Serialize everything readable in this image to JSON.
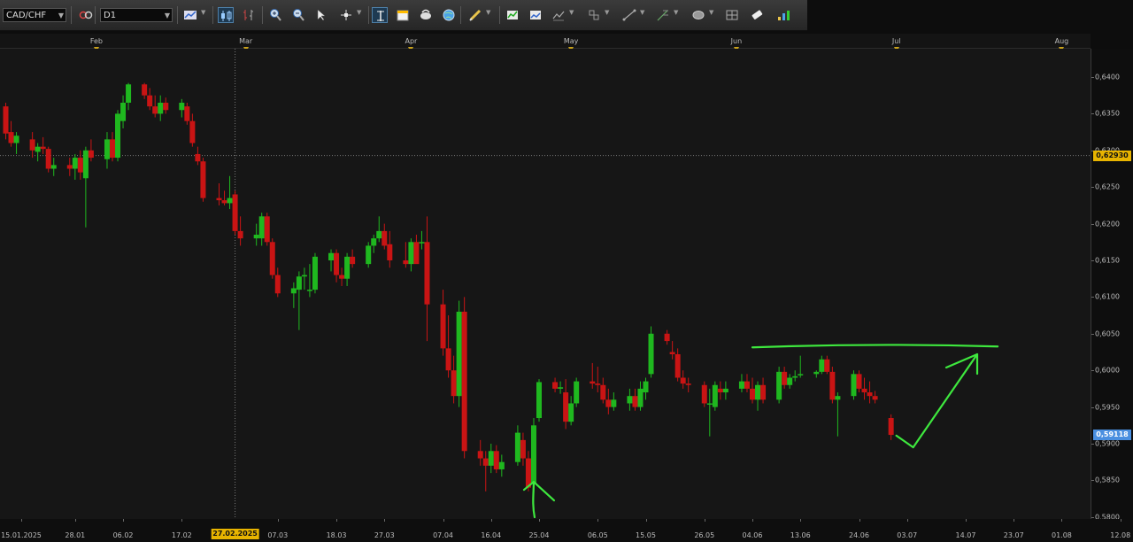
{
  "toolbar": {
    "symbol": "CAD/CHF",
    "timeframe": "D1",
    "buttons": [
      {
        "name": "link-icon",
        "x": 88,
        "drop": false,
        "active": false
      },
      {
        "name": "line-chart-icon",
        "x": 206,
        "drop": true,
        "active": false
      },
      {
        "name": "candlestick-icon",
        "x": 246,
        "drop": false,
        "active": true
      },
      {
        "name": "bar-chart-icon",
        "x": 272,
        "drop": false,
        "active": false
      },
      {
        "name": "zoom-in-icon",
        "x": 302,
        "drop": false,
        "active": false
      },
      {
        "name": "zoom-out-icon",
        "x": 328,
        "drop": false,
        "active": false
      },
      {
        "name": "cursor-icon",
        "x": 354,
        "drop": false,
        "active": false
      },
      {
        "name": "crosshair-icon",
        "x": 382,
        "drop": true,
        "active": false
      },
      {
        "name": "period-separator-icon",
        "x": 420,
        "drop": false,
        "active": true
      },
      {
        "name": "new-order-icon",
        "x": 446,
        "drop": false,
        "active": false
      },
      {
        "name": "chart-shift-icon",
        "x": 472,
        "drop": false,
        "active": false
      },
      {
        "name": "globe-icon",
        "x": 498,
        "drop": false,
        "active": false
      },
      {
        "name": "pencil-icon",
        "x": 528,
        "drop": true,
        "active": false
      },
      {
        "name": "templates-icon",
        "x": 570,
        "drop": false,
        "active": false
      },
      {
        "name": "screenshot-icon",
        "x": 596,
        "drop": false,
        "active": false
      },
      {
        "name": "indicators-icon",
        "x": 622,
        "drop": true,
        "active": false
      },
      {
        "name": "objects-icon",
        "x": 662,
        "drop": true,
        "active": false
      },
      {
        "name": "trendline-icon",
        "x": 702,
        "drop": true,
        "active": false
      },
      {
        "name": "fibonacci-icon",
        "x": 740,
        "drop": true,
        "active": false
      },
      {
        "name": "shapes-icon",
        "x": 780,
        "drop": true,
        "active": false
      },
      {
        "name": "grid-icon",
        "x": 818,
        "drop": false,
        "active": false
      },
      {
        "name": "eraser-icon",
        "x": 846,
        "drop": false,
        "active": false
      },
      {
        "name": "signals-icon",
        "x": 876,
        "drop": false,
        "active": false
      }
    ]
  },
  "months": [
    "Feb",
    "Mar",
    "Apr",
    "May",
    "Jun",
    "Jul",
    "Aug"
  ],
  "price_labels": [
    "0,6400",
    "0,6350",
    "0,6300",
    "0,6250",
    "0,6200",
    "0,6150",
    "0,6100",
    "0,6050",
    "0,6000",
    "0,5950",
    "0,5900",
    "0,5850",
    "0,5800"
  ],
  "date_labels": [
    "15.01.2025",
    "28.01",
    "06.02",
    "17.02",
    "27.02.2025",
    "07.03",
    "18.03",
    "27.03",
    "07.04",
    "16.04",
    "25.04",
    "06.05",
    "15.05",
    "26.05",
    "04.06",
    "13.06",
    "24.06",
    "03.07",
    "14.07",
    "23.07",
    "01.08",
    "12.08"
  ],
  "crosshair": {
    "price": "0,62930",
    "date": "27.02.2025"
  },
  "current_price": "0,59118",
  "colors": {
    "bull": "#1fb81f",
    "bear": "#c91414",
    "annotation": "#3ee83e",
    "crosshair_badge": "#e8b400",
    "price_badge": "#4a8fe0"
  },
  "chart_data": {
    "type": "candlestick",
    "symbol": "CAD/CHF",
    "timeframe": "D1",
    "ylim": [
      0.579,
      0.642
    ],
    "candles": [
      [
        "2025-01-15",
        0.636,
        0.6365,
        0.6315,
        0.6323
      ],
      [
        "2025-01-16",
        0.6325,
        0.634,
        0.6305,
        0.631
      ],
      [
        "2025-01-17",
        0.631,
        0.6325,
        0.6295,
        0.632
      ],
      [
        "2025-01-20",
        0.6315,
        0.6325,
        0.629,
        0.63
      ],
      [
        "2025-01-21",
        0.6298,
        0.631,
        0.6285,
        0.6305
      ],
      [
        "2025-01-22",
        0.6305,
        0.6318,
        0.6295,
        0.6302
      ],
      [
        "2025-01-23",
        0.6302,
        0.6305,
        0.627,
        0.6275
      ],
      [
        "2025-01-24",
        0.6275,
        0.629,
        0.6265,
        0.628
      ],
      [
        "2025-01-27",
        0.628,
        0.629,
        0.6265,
        0.6275
      ],
      [
        "2025-01-28",
        0.6275,
        0.6295,
        0.626,
        0.629
      ],
      [
        "2025-01-29",
        0.629,
        0.63,
        0.626,
        0.627
      ],
      [
        "2025-01-30",
        0.6262,
        0.6305,
        0.6195,
        0.63
      ],
      [
        "2025-01-31",
        0.63,
        0.6315,
        0.6285,
        0.629
      ],
      [
        "2025-02-03",
        0.6288,
        0.6325,
        0.6275,
        0.6315
      ],
      [
        "2025-02-04",
        0.6315,
        0.6325,
        0.6285,
        0.629
      ],
      [
        "2025-02-05",
        0.629,
        0.6355,
        0.6285,
        0.635
      ],
      [
        "2025-02-06",
        0.634,
        0.6375,
        0.633,
        0.6365
      ],
      [
        "2025-02-07",
        0.6365,
        0.6392,
        0.6355,
        0.639
      ],
      [
        "2025-02-10",
        0.639,
        0.6392,
        0.637,
        0.6375
      ],
      [
        "2025-02-11",
        0.6375,
        0.6385,
        0.6355,
        0.636
      ],
      [
        "2025-02-12",
        0.636,
        0.6375,
        0.6345,
        0.635
      ],
      [
        "2025-02-13",
        0.635,
        0.6375,
        0.634,
        0.6365
      ],
      [
        "2025-02-14",
        0.6365,
        0.6372,
        0.635,
        0.6355
      ],
      [
        "2025-02-17",
        0.6355,
        0.637,
        0.6345,
        0.6365
      ],
      [
        "2025-02-18",
        0.636,
        0.6365,
        0.6335,
        0.634
      ],
      [
        "2025-02-19",
        0.634,
        0.635,
        0.6305,
        0.631
      ],
      [
        "2025-02-20",
        0.6295,
        0.6305,
        0.628,
        0.6285
      ],
      [
        "2025-02-21",
        0.6285,
        0.629,
        0.623,
        0.6235
      ],
      [
        "2025-02-24",
        0.6235,
        0.6255,
        0.6225,
        0.6232
      ],
      [
        "2025-02-25",
        0.6232,
        0.6245,
        0.6225,
        0.6228
      ],
      [
        "2025-02-26",
        0.6228,
        0.6265,
        0.622,
        0.6235
      ],
      [
        "2025-02-27",
        0.624,
        0.6245,
        0.6185,
        0.619
      ],
      [
        "2025-02-28",
        0.619,
        0.621,
        0.617,
        0.618
      ],
      [
        "2025-03-03",
        0.618,
        0.62,
        0.617,
        0.6185
      ],
      [
        "2025-03-04",
        0.618,
        0.6215,
        0.617,
        0.621
      ],
      [
        "2025-03-05",
        0.621,
        0.6215,
        0.617,
        0.6175
      ],
      [
        "2025-03-06",
        0.6175,
        0.618,
        0.6125,
        0.613
      ],
      [
        "2025-03-07",
        0.613,
        0.614,
        0.61,
        0.6105
      ],
      [
        "2025-03-10",
        0.6105,
        0.612,
        0.6085,
        0.6112
      ],
      [
        "2025-03-11",
        0.611,
        0.6135,
        0.6055,
        0.6128
      ],
      [
        "2025-03-12",
        0.6128,
        0.614,
        0.611,
        0.613
      ],
      [
        "2025-03-13",
        0.611,
        0.6145,
        0.61,
        0.611
      ],
      [
        "2025-03-14",
        0.611,
        0.616,
        0.6105,
        0.6155
      ],
      [
        "2025-03-17",
        0.615,
        0.6165,
        0.6135,
        0.616
      ],
      [
        "2025-03-18",
        0.616,
        0.6165,
        0.612,
        0.613
      ],
      [
        "2025-03-19",
        0.613,
        0.614,
        0.6115,
        0.6125
      ],
      [
        "2025-03-20",
        0.6125,
        0.616,
        0.6115,
        0.6155
      ],
      [
        "2025-03-21",
        0.6155,
        0.6165,
        0.614,
        0.6145
      ],
      [
        "2025-03-24",
        0.6145,
        0.6175,
        0.614,
        0.617
      ],
      [
        "2025-03-25",
        0.617,
        0.6185,
        0.616,
        0.618
      ],
      [
        "2025-03-26",
        0.618,
        0.621,
        0.6175,
        0.619
      ],
      [
        "2025-03-27",
        0.619,
        0.62,
        0.6165,
        0.617
      ],
      [
        "2025-03-28",
        0.6172,
        0.619,
        0.614,
        0.615
      ],
      [
        "2025-03-31",
        0.615,
        0.6175,
        0.614,
        0.6145
      ],
      [
        "2025-04-01",
        0.6145,
        0.618,
        0.6135,
        0.6175
      ],
      [
        "2025-04-02",
        0.6175,
        0.6185,
        0.6155,
        0.6145
      ],
      [
        "2025-04-03",
        0.6175,
        0.619,
        0.6165,
        0.6175
      ],
      [
        "2025-04-04",
        0.6175,
        0.621,
        0.604,
        0.609
      ],
      [
        "2025-04-07",
        0.609,
        0.611,
        0.602,
        0.603
      ],
      [
        "2025-04-08",
        0.603,
        0.6075,
        0.599,
        0.6
      ],
      [
        "2025-04-09",
        0.6,
        0.602,
        0.5955,
        0.5965
      ],
      [
        "2025-04-10",
        0.5965,
        0.6095,
        0.595,
        0.608
      ],
      [
        "2025-04-11",
        0.608,
        0.61,
        0.588,
        0.589
      ],
      [
        "2025-04-14",
        0.589,
        0.5905,
        0.587,
        0.588
      ],
      [
        "2025-04-15",
        0.588,
        0.589,
        0.5835,
        0.587
      ],
      [
        "2025-04-16",
        0.587,
        0.59,
        0.586,
        0.589
      ],
      [
        "2025-04-17",
        0.589,
        0.5898,
        0.586,
        0.5865
      ],
      [
        "2025-04-18",
        0.5865,
        0.5885,
        0.5855,
        0.5875
      ],
      [
        "2025-04-21",
        0.5875,
        0.5925,
        0.587,
        0.5915
      ],
      [
        "2025-04-22",
        0.5905,
        0.5915,
        0.587,
        0.588
      ],
      [
        "2025-04-23",
        0.588,
        0.589,
        0.5835,
        0.584
      ],
      [
        "2025-04-24",
        0.5845,
        0.5935,
        0.584,
        0.5925
      ],
      [
        "2025-04-25",
        0.5935,
        0.5988,
        0.593,
        0.5984
      ],
      [
        "2025-04-28",
        0.5984,
        0.599,
        0.597,
        0.5975
      ],
      [
        "2025-04-29",
        0.5975,
        0.5985,
        0.5968,
        0.5977
      ],
      [
        "2025-04-30",
        0.597,
        0.5988,
        0.592,
        0.593
      ],
      [
        "2025-05-01",
        0.593,
        0.5965,
        0.5925,
        0.5955
      ],
      [
        "2025-05-02",
        0.5955,
        0.599,
        0.595,
        0.5985
      ],
      [
        "2025-05-05",
        0.5985,
        0.601,
        0.5975,
        0.5982
      ],
      [
        "2025-05-06",
        0.5982,
        0.6005,
        0.597,
        0.598
      ],
      [
        "2025-05-07",
        0.598,
        0.599,
        0.5955,
        0.596
      ],
      [
        "2025-05-08",
        0.596,
        0.5975,
        0.594,
        0.595
      ],
      [
        "2025-05-09",
        0.595,
        0.597,
        0.5945,
        0.596
      ],
      [
        "2025-05-12",
        0.5955,
        0.5975,
        0.5945,
        0.5965
      ],
      [
        "2025-05-13",
        0.5965,
        0.5975,
        0.5945,
        0.595
      ],
      [
        "2025-05-14",
        0.595,
        0.5985,
        0.5945,
        0.5975
      ],
      [
        "2025-05-15",
        0.597,
        0.599,
        0.596,
        0.5985
      ],
      [
        "2025-05-16",
        0.5995,
        0.606,
        0.599,
        0.605
      ],
      [
        "2025-05-19",
        0.605,
        0.6055,
        0.6035,
        0.604
      ],
      [
        "2025-05-20",
        0.6025,
        0.604,
        0.6015,
        0.6022
      ],
      [
        "2025-05-21",
        0.6022,
        0.603,
        0.5985,
        0.599
      ],
      [
        "2025-05-22",
        0.599,
        0.6,
        0.5975,
        0.5982
      ],
      [
        "2025-05-23",
        0.5982,
        0.599,
        0.597,
        0.598
      ],
      [
        "2025-05-26",
        0.598,
        0.5985,
        0.595,
        0.5955
      ],
      [
        "2025-05-27",
        0.5955,
        0.5975,
        0.591,
        0.5955
      ],
      [
        "2025-05-28",
        0.595,
        0.5985,
        0.5945,
        0.598
      ],
      [
        "2025-05-29",
        0.5975,
        0.5985,
        0.596,
        0.597
      ],
      [
        "2025-05-30",
        0.597,
        0.5985,
        0.596,
        0.5975
      ],
      [
        "2025-06-02",
        0.5975,
        0.5995,
        0.597,
        0.5985
      ],
      [
        "2025-06-03",
        0.5985,
        0.5995,
        0.597,
        0.5975
      ],
      [
        "2025-06-04",
        0.5975,
        0.599,
        0.5955,
        0.596
      ],
      [
        "2025-06-05",
        0.596,
        0.5985,
        0.5945,
        0.598
      ],
      [
        "2025-06-06",
        0.598,
        0.599,
        0.5955,
        0.596
      ],
      [
        "2025-06-09",
        0.596,
        0.6005,
        0.5955,
        0.5998
      ],
      [
        "2025-06-10",
        0.5998,
        0.6005,
        0.5975,
        0.598
      ],
      [
        "2025-06-11",
        0.598,
        0.5995,
        0.5975,
        0.599
      ],
      [
        "2025-06-12",
        0.599,
        0.6,
        0.5985,
        0.5992
      ],
      [
        "2025-06-13",
        0.5995,
        0.602,
        0.599,
        0.5995
      ],
      [
        "2025-06-16",
        0.5995,
        0.6,
        0.599,
        0.5998
      ],
      [
        "2025-06-17",
        0.5998,
        0.602,
        0.5995,
        0.6015
      ],
      [
        "2025-06-18",
        0.6015,
        0.602,
        0.5995,
        0.5998
      ],
      [
        "2025-06-19",
        0.5998,
        0.6005,
        0.5955,
        0.596
      ],
      [
        "2025-06-20",
        0.596,
        0.597,
        0.591,
        0.5965
      ],
      [
        "2025-06-23",
        0.5965,
        0.6,
        0.596,
        0.5995
      ],
      [
        "2025-06-24",
        0.5995,
        0.6,
        0.597,
        0.5975
      ],
      [
        "2025-06-25",
        0.5975,
        0.599,
        0.596,
        0.597
      ],
      [
        "2025-06-26",
        0.597,
        0.5985,
        0.5955,
        0.5965
      ],
      [
        "2025-06-27",
        0.5965,
        0.5972,
        0.5955,
        0.596
      ],
      [
        "2025-06-30",
        0.5935,
        0.594,
        0.5905,
        0.5912
      ]
    ],
    "crosshair_date": "2025-02-27",
    "crosshair_price": 0.6293,
    "annotations": [
      {
        "type": "arrow-up",
        "at": "2025-04-24",
        "price": 0.5848
      },
      {
        "type": "horizontal-line",
        "from": "2025-06-04",
        "to": "2025-07-20",
        "price": 0.6035
      },
      {
        "type": "check-arrow",
        "from": "2025-07-01",
        "to": "2025-07-15",
        "price_low": 0.5895,
        "price_high": 0.6022
      }
    ]
  }
}
